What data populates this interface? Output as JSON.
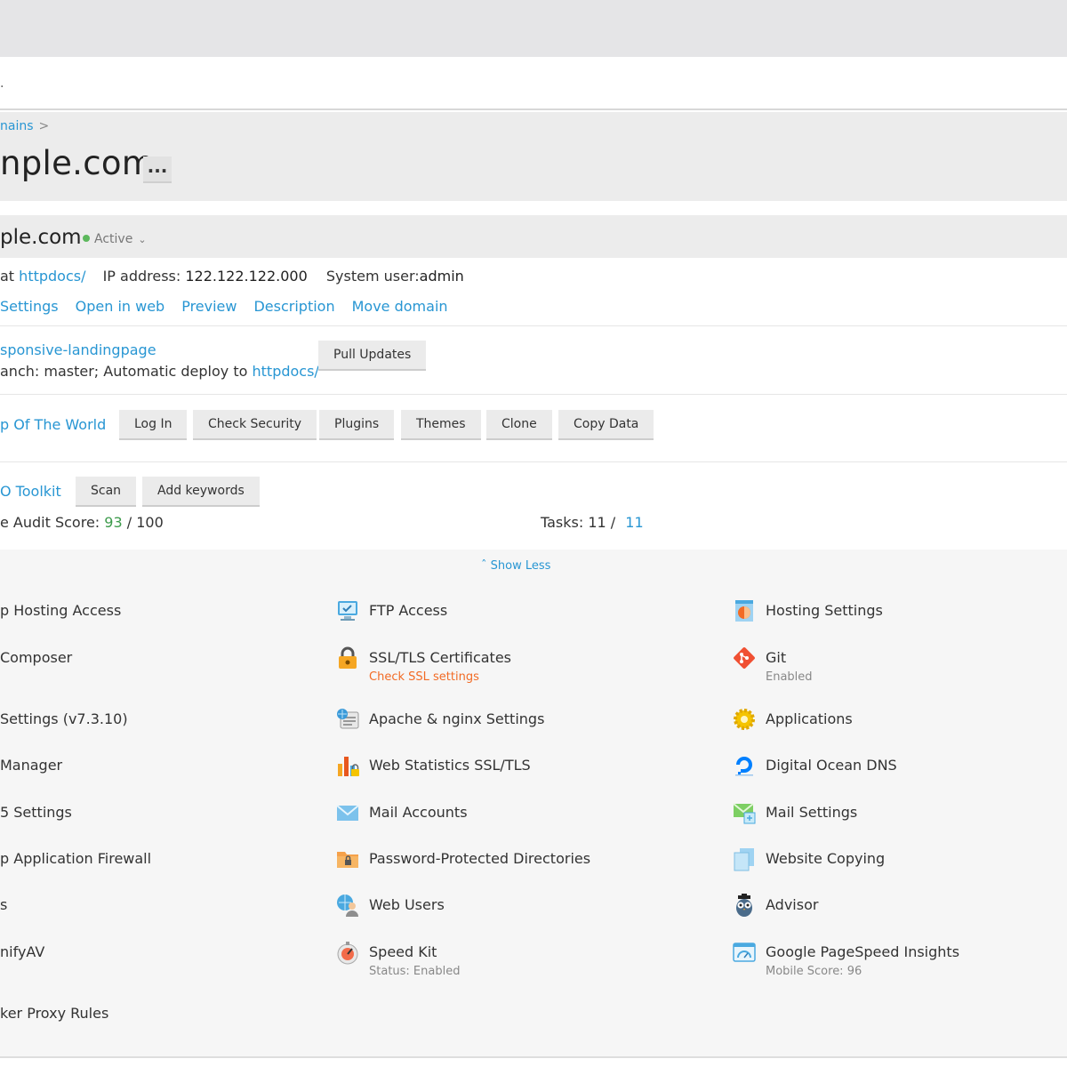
{
  "path_fragment": ".",
  "breadcrumb": {
    "item": "nains",
    "separator": ">"
  },
  "page_title": "nple.com",
  "more_button": "...",
  "domain_bar": {
    "name": "ple.com",
    "status": "Active"
  },
  "info": {
    "at_label": "at",
    "docroot": "httpdocs/",
    "ip_label": "IP address:",
    "ip": "122.122.122.000",
    "user_label": "System user:",
    "user": "admin"
  },
  "domain_links": [
    "Settings",
    "Open in web",
    "Preview",
    "Description",
    "Move domain"
  ],
  "git": {
    "repo": "sponsive-landingpage",
    "deploy_text": "anch: master; Automatic deploy to",
    "deploy_target": "httpdocs/",
    "pull_button": "Pull Updates"
  },
  "wordpress": {
    "site": "p Of The World",
    "buttons": [
      "Log In",
      "Check Security",
      "Plugins",
      "Themes",
      "Clone",
      "Copy Data"
    ]
  },
  "seo": {
    "title": "O Toolkit",
    "buttons": [
      "Scan",
      "Add keywords"
    ],
    "audit_label": "e Audit Score:",
    "audit_score": "93",
    "audit_total": "/ 100",
    "tasks_label": "Tasks:",
    "tasks_done": "11 /",
    "tasks_total": "11"
  },
  "show_less": "Show Less",
  "tools": {
    "col1": [
      "p Hosting Access",
      " Composer",
      " Settings (v7.3.10)",
      "Manager",
      "5 Settings",
      "p Application Firewall",
      "s",
      "nifyAV",
      "ker Proxy Rules"
    ],
    "col2": [
      {
        "label": "FTP Access",
        "icon": "ftp-access-icon"
      },
      {
        "label": "SSL/TLS Certificates",
        "sub": "Check SSL settings",
        "icon": "ssl-lock-icon"
      },
      {
        "label": "Apache & nginx Settings",
        "icon": "apache-nginx-icon"
      },
      {
        "label": "Web Statistics SSL/TLS",
        "icon": "web-statistics-icon"
      },
      {
        "label": "Mail Accounts",
        "icon": "mail-accounts-icon"
      },
      {
        "label": "Password-Protected Directories",
        "icon": "protected-folder-icon"
      },
      {
        "label": "Web Users",
        "icon": "web-users-icon"
      },
      {
        "label": "Speed Kit",
        "sub": "Status: Enabled",
        "icon": "speed-kit-icon"
      }
    ],
    "col3": [
      {
        "label": "Hosting Settings",
        "icon": "hosting-settings-icon"
      },
      {
        "label": "Git",
        "sub": "Enabled",
        "icon": "git-icon"
      },
      {
        "label": "Applications",
        "icon": "applications-gear-icon"
      },
      {
        "label": "Digital Ocean DNS",
        "icon": "digital-ocean-icon"
      },
      {
        "label": "Mail Settings",
        "icon": "mail-settings-icon"
      },
      {
        "label": "Website Copying",
        "icon": "website-copying-icon"
      },
      {
        "label": "Advisor",
        "icon": "advisor-owl-icon"
      },
      {
        "label": "Google PageSpeed Insights",
        "sub": "Mobile Score: 96",
        "icon": "pagespeed-icon"
      }
    ]
  },
  "colors": {
    "link": "#2896d3",
    "active_led": "#5cb85c",
    "score": "#3d9b4c",
    "warning": "#f26b25"
  }
}
